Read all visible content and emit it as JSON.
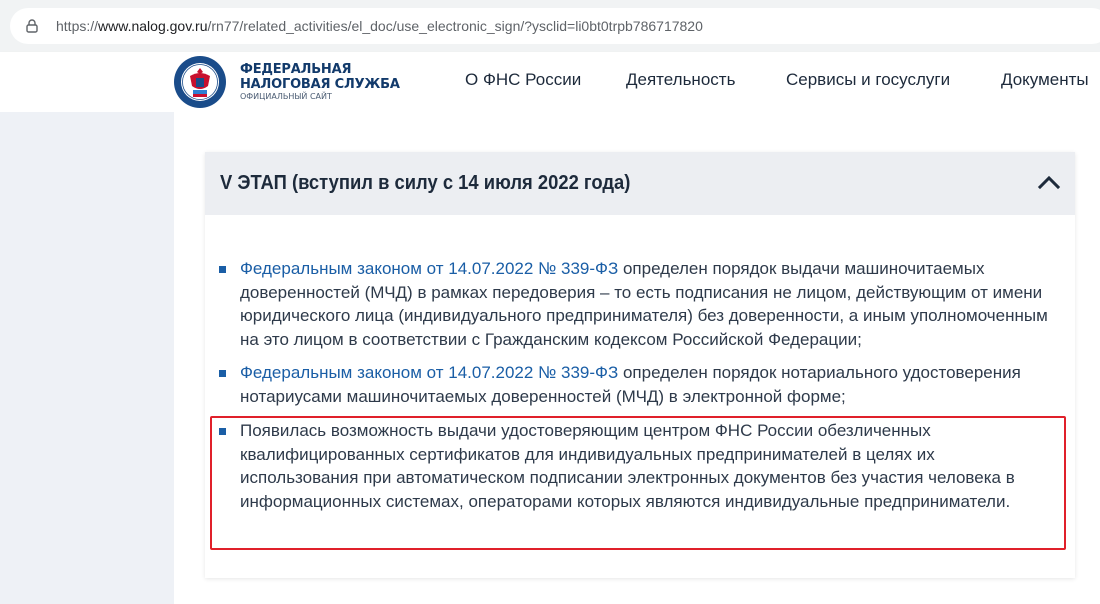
{
  "browser": {
    "url_prefix": "https://",
    "url_host": "www.nalog.gov.ru",
    "url_path": "/rn77/related_activities/el_doc/use_electronic_sign/?ysclid=li0bt0trpb786717820"
  },
  "site": {
    "logo_line1": "ФЕДЕРАЛЬНАЯ",
    "logo_line2": "НАЛОГОВАЯ СЛУЖБА",
    "logo_sub": "ОФИЦИАЛЬНЫЙ САЙТ",
    "nav": [
      {
        "label": "О ФНС России"
      },
      {
        "label": "Деятельность"
      },
      {
        "label": "Сервисы и госуслуги"
      },
      {
        "label": "Документы"
      }
    ],
    "colors": {
      "brand": "#123a6b",
      "link": "#1a5ea6",
      "highlight": "#e0202a"
    }
  },
  "accordion": {
    "title": "V ЭТАП (вступил в силу с 14 июля 2022 года)",
    "items": [
      {
        "link": "Федеральным законом от 14.07.2022 № 339-ФЗ",
        "text": " определен порядок выдачи машиночитаемых доверенностей (МЧД) в рамках передоверия – то есть подписания не лицом, действующим от имени юридического лица (индивидуального предпринимателя) без доверенности, а иным уполномоченным на это лицом в соответствии с Гражданским кодексом Российской Федерации;"
      },
      {
        "link": "Федеральным законом от 14.07.2022 № 339-ФЗ",
        "text": " определен порядок нотариального удостоверения нотариусами машиночитаемых доверенностей (МЧД) в электронной форме;"
      },
      {
        "link": "",
        "text": "Появилась возможность выдачи удостоверяющим центром ФНС России обезличенных квалифицированных сертификатов для индивидуальных предпринимателей в целях их использования при автоматическом подписании электронных документов без участия человека в информационных системах, операторами которых являются индивидуальные предприниматели."
      }
    ]
  }
}
